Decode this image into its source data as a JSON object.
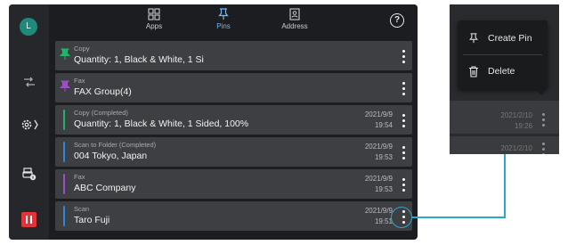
{
  "user": {
    "avatar_initial": "L"
  },
  "tabs": [
    {
      "label": "Apps",
      "icon": "apps-grid-icon",
      "active": false
    },
    {
      "label": "Pins",
      "icon": "pin-icon",
      "active": true
    },
    {
      "label": "Address",
      "icon": "address-book-icon",
      "active": false
    }
  ],
  "help_label": "?",
  "side_rail": [
    {
      "icon": "job-status-icon"
    },
    {
      "icon": "settings-gear-icon"
    },
    {
      "icon": "printer-info-icon"
    },
    {
      "icon": "pause-icon"
    }
  ],
  "jobs": [
    {
      "type": "Copy",
      "description": "Quantity: 1, Black & White, 1 Si",
      "date": "",
      "time": "",
      "pinned": true,
      "accent": "#1fb46a"
    },
    {
      "type": "Fax",
      "description": "FAX Group(4)",
      "date": "",
      "time": "",
      "pinned": true,
      "accent": "#9b4fc0"
    },
    {
      "type": "Copy (Completed)",
      "description": "Quantity: 1, Black & White, 1 Sided, 100%",
      "date": "2021/9/9",
      "time": "19:54",
      "pinned": false,
      "accent": "#1fb46a"
    },
    {
      "type": "Scan to Folder (Completed)",
      "description": "004 Tokyo, Japan",
      "date": "2021/9/9",
      "time": "19:53",
      "pinned": false,
      "accent": "#2f86e0"
    },
    {
      "type": "Fax",
      "description": "ABC Company",
      "date": "2021/9/9",
      "time": "19:53",
      "pinned": false,
      "accent": "#9b4fc0"
    },
    {
      "type": "Scan",
      "description": "Taro Fuji",
      "date": "2021/9/9",
      "time": "19:51",
      "pinned": false,
      "accent": "#2f86e0"
    }
  ],
  "context_menu": {
    "items": [
      {
        "label": "Create Pin",
        "icon": "pin-icon"
      },
      {
        "label": "Delete",
        "icon": "trash-icon"
      }
    ],
    "background_rows": [
      {
        "date": "2021/2/10",
        "time": "19:26"
      },
      {
        "date": "2021/2/10",
        "time": ""
      }
    ]
  },
  "colors": {
    "highlight": "#2ea7c6",
    "active_tab": "#6fb8ff",
    "pause": "#e0333a"
  }
}
